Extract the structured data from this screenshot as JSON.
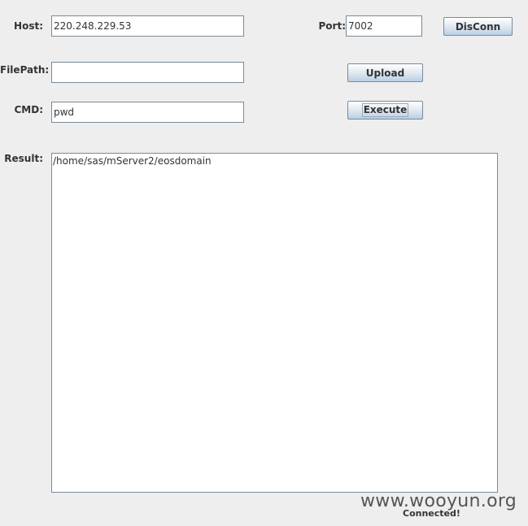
{
  "form": {
    "host_label": "Host:",
    "host_value": "220.248.229.53",
    "port_label": "Port:",
    "port_value": "7002",
    "filepath_label": "FilePath:",
    "filepath_value": "",
    "cmd_label": "CMD:",
    "cmd_value": "pwd",
    "result_label": "Result:",
    "result_value": "/home/sas/mServer2/eosdomain"
  },
  "buttons": {
    "disconnect_label": "DisConn",
    "upload_label": "Upload",
    "execute_label": "Execute"
  },
  "status": {
    "text": "Connected!"
  },
  "watermark": {
    "text": "www.wooyun.org"
  }
}
